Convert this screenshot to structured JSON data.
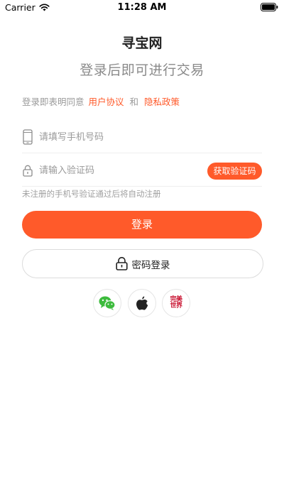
{
  "status_bar": {
    "carrier": "Carrier",
    "time": "11:28 AM"
  },
  "app": {
    "title": "寻宝网",
    "subtitle": "登录后即可进行交易"
  },
  "agreement": {
    "prefix": "登录即表明同意",
    "user_agreement": "用户协议",
    "conjunction": "和",
    "privacy_policy": "隐私政策"
  },
  "phone_field": {
    "placeholder": "请填写手机号码",
    "value": ""
  },
  "code_field": {
    "placeholder": "请输入验证码",
    "value": ""
  },
  "get_code_label": "获取验证码",
  "hint": "未注册的手机号验证通过后将自动注册",
  "login_label": "登录",
  "password_login_label": "密码登录",
  "social_logins": {
    "wmsj_logo_text": "完美世界"
  },
  "colors": {
    "accent": "#ff5a2a",
    "wechat": "#3dbb3d",
    "wmsj": "#c8102e"
  }
}
